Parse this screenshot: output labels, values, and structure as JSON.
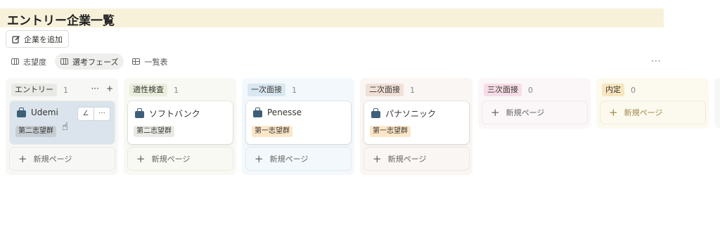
{
  "page": {
    "title": "エントリー企業一覧"
  },
  "toolbar": {
    "add_label": "企業を追加",
    "add_icon": "edit-icon"
  },
  "views": [
    {
      "label": "志望度",
      "icon": "board-icon",
      "active": false
    },
    {
      "label": "選考フェーズ",
      "icon": "board-icon",
      "active": true
    },
    {
      "label": "一覧表",
      "icon": "table-icon",
      "active": false
    }
  ],
  "more_label": "···",
  "columns": [
    {
      "name": "エントリー",
      "count": "1",
      "tag_bg": "#e9e9e6",
      "col_bg": "#f7f7f5",
      "cards": [
        {
          "title": "Udemi",
          "tag": "第二志望群",
          "tag_bg": "#dcdcd9"
        }
      ],
      "new_label": "新規ページ"
    },
    {
      "name": "適性検査",
      "count": "1",
      "tag_bg": "#e9eedd",
      "col_bg": "#f8f9f3",
      "cards": [
        {
          "title": "ソフトバンク",
          "tag": "第二志望群",
          "tag_bg": "#e9e9e6"
        }
      ],
      "new_label": "新規ページ"
    },
    {
      "name": "一次面接",
      "count": "1",
      "tag_bg": "#d9e7f2",
      "col_bg": "#f3f8fc",
      "cards": [
        {
          "title": "Penesse",
          "tag": "第一志望群",
          "tag_bg": "#fbe6c8"
        }
      ],
      "new_label": "新規ページ"
    },
    {
      "name": "二次面接",
      "count": "1",
      "tag_bg": "#f0e0d8",
      "col_bg": "#f9f6f3",
      "cards": [
        {
          "title": "パナソニック",
          "tag": "第一志望群",
          "tag_bg": "#fbe6c8"
        }
      ],
      "new_label": "新規ページ"
    },
    {
      "name": "三次面接",
      "count": "0",
      "tag_bg": "#f7dde8",
      "col_bg": "#fbf6f8",
      "cards": [],
      "new_label": "新規ページ"
    },
    {
      "name": "内定",
      "count": "0",
      "tag_bg": "#f9e6bf",
      "col_bg": "#fcf9ee",
      "cards": [],
      "new_label": "新規ページ"
    }
  ],
  "column_actions": {
    "more": "···",
    "add": "+"
  },
  "card_actions": {
    "edit": "∠",
    "more": "···"
  },
  "plus_symbol": "+"
}
